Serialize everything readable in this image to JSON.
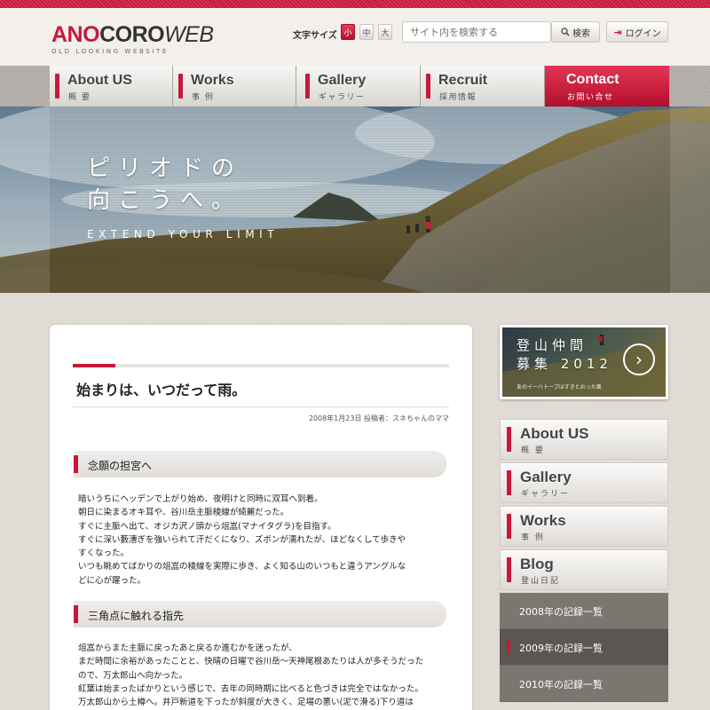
{
  "header": {
    "logo": {
      "ano": "ANO",
      "coro": "CORO",
      "web": "WEB",
      "tagline": "OLD LOOKING WEBSITE"
    },
    "font_size": {
      "label": "文字サイズ",
      "small": "小",
      "medium": "中",
      "large": "大",
      "selected": "小"
    },
    "search": {
      "placeholder": "サイト内を検索する",
      "button_label": "検索"
    },
    "login_label": "ログイン"
  },
  "nav": {
    "items": [
      {
        "en": "About US",
        "ja": "概 要"
      },
      {
        "en": "Works",
        "ja": "事 例"
      },
      {
        "en": "Gallery",
        "ja": "ギャラリー"
      },
      {
        "en": "Recruit",
        "ja": "採用情報"
      },
      {
        "en": "Contact",
        "ja": "お問い合せ"
      }
    ],
    "active": "Contact"
  },
  "hero": {
    "line1": "ピリオドの",
    "line2": "向こうへ。",
    "subtitle": "EXTEND YOUR LIMIT"
  },
  "article": {
    "title": "始まりは、いつだって雨。",
    "meta": "2008年1月23日 投稿者：スネちゃんのママ",
    "sections": [
      {
        "heading": "念願の担宮へ",
        "lines": [
          "暗いうちにヘッデンで上がり始め、夜明けと同時に双耳へ到着。",
          "朝日に染まるオキ耳や、谷川岳主脈稜線が綺麗だった。",
          "すぐに主脈へ出て、オジカ沢ノ頭から俎嵓(マナイタグラ)を目指す。",
          "すぐに深い藪漕ぎを強いられて汗だくになり、ズボンが濡れたが、ほどなくして歩きや",
          "すくなった。",
          "いつも眺めてばかりの俎嵓の稜線を実際に歩き、よく知る山のいつもと違うアングルな",
          "どに心が躍った。"
        ]
      },
      {
        "heading": "三角点に触れる指先",
        "lines": [
          "俎嵓からまた主脈に戻ったあと戻るか進むかを迷ったが、",
          "まだ時間に余裕があったことと、快晴の日曜で谷川岳〜天神尾根あたりは人が多そうだった",
          "ので、万太郎山へ向かった。",
          "紅葉は始まったばかりという感じで、去年の同時期に比べると色づきは完全ではなかった。",
          "万太郎山から土樽へ。井戸新道を下ったが斜度が大きく、足場の悪い(泥で滑る)下り道は"
        ]
      }
    ]
  },
  "sidebar": {
    "banner": {
      "title_line1": "登山仲間",
      "title_line2": "募集 2012",
      "caption": "あのイーハトーブはすきとおった風"
    },
    "items": [
      {
        "en": "About US",
        "ja": "概 要"
      },
      {
        "en": "Gallery",
        "ja": "ギャラリー"
      },
      {
        "en": "Works",
        "ja": "事 例"
      },
      {
        "en": "Blog",
        "ja": "登山日記"
      }
    ],
    "blog_archive": [
      {
        "label": "2008年の記録一覧"
      },
      {
        "label": "2009年の記録一覧"
      },
      {
        "label": "2010年の記録一覧"
      }
    ],
    "archive_selected": "2009年の記録一覧"
  },
  "colors": {
    "accent": "#c8183a",
    "background": "#e4ded8",
    "sidebar_sub": "#7b7670"
  }
}
